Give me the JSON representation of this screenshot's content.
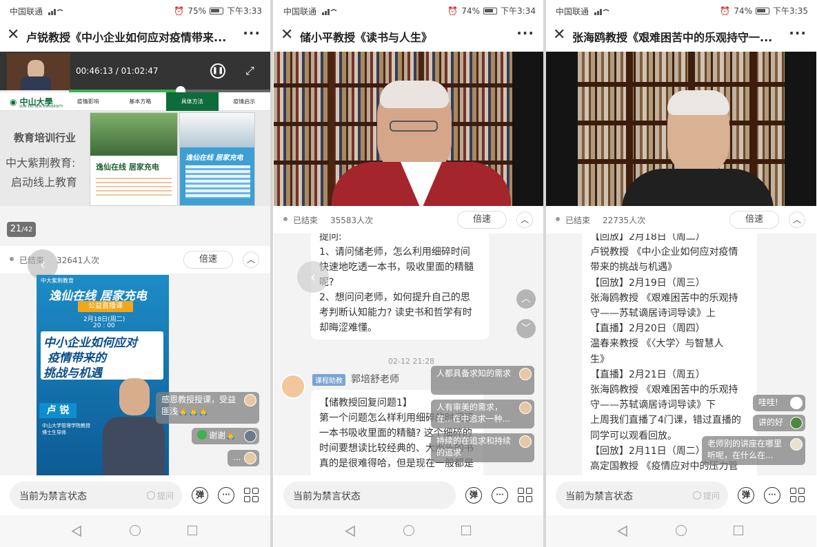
{
  "phones": [
    {
      "status": {
        "carrier": "中国联通",
        "battery": "75%",
        "time": "下午3:33"
      },
      "title": "卢锐教授《中小企业如何应对疫情带来...",
      "video": {
        "time": "00:46:13 / 01:02:47",
        "progress": 0.74,
        "logo": "中山大學",
        "logo_en": "SUN YAT-SEN UNIVERSITY",
        "tabs": [
          "疫情影响",
          "基本方略",
          "具体方法",
          "疫情启示"
        ],
        "active_tab": 2,
        "slide_heading": "教育培训行业",
        "slide_lines": [
          "中大紫荆教育:",
          "启动线上教育"
        ],
        "page_num": "21",
        "page_total": "/42",
        "poster1": "逸仙在线 居家充电",
        "poster2": "逸仙在线 居家充电"
      },
      "info": {
        "ended": "已结束",
        "viewers": "32641人次",
        "speed": "倍速"
      },
      "poster": {
        "brand": "中大紫荆教育",
        "headline": "逸仙在线 居家充电",
        "sub": "公益直播课",
        "date": "2月18日(周二)",
        "hour": "20 : 00",
        "topic_lines": [
          "中小企业如何应对",
          "疫情带来的",
          "挑战与机遇"
        ],
        "speaker": "卢 锐",
        "speaker_desc_lines": [
          "中山大学管理学院教授",
          "博士生导师"
        ]
      },
      "danmu": [
        {
          "text": "感恩教授授课，受益匪浅🙏🙏🙏"
        },
        {
          "text": "谢谢🙏"
        },
        {
          "text": "..."
        }
      ],
      "input": {
        "placeholder": "当前为禁言状态",
        "ask": "提问"
      }
    },
    {
      "status": {
        "carrier": "中国联通",
        "battery": "74%",
        "time": "下午3:34"
      },
      "title": "储小平教授《读书与人生》",
      "info": {
        "ended": "已结束",
        "viewers": "35583人次",
        "speed": "倍速"
      },
      "question_lines": [
        "提问:",
        "1、请问储老师，怎么利用细碎时间",
        "快速地吃透一本书，吸收里面的精髓",
        "呢?",
        "2、想问问老师，如何提升自己的思",
        "考判断认知能力? 读史书和哲学有时",
        "却晦涩难懂。"
      ],
      "timestamp": "02-12 21:28",
      "assistant_badge": "课程助教",
      "assistant_name": "郭培舒老师",
      "reply_lines": [
        "【储教授回复问题1】",
        "第一个问题怎么样利用细碎的时间读",
        "一本书吸收里面的精髓? 这个细碎的",
        "时间要想读比较经典的、大部头的书",
        "真的是很难得哈，但是现在一般都是"
      ],
      "danmu": [
        {
          "text": "人都具备求知的需求"
        },
        {
          "text": "人有审美的需求，在...在中追求一种..."
        },
        {
          "text": "持续的在追求和持续的追求"
        }
      ],
      "input": {
        "placeholder": "当前为禁言状态"
      }
    },
    {
      "status": {
        "carrier": "中国联通",
        "battery": "74%",
        "time": "下午3:35"
      },
      "title": "张海鸥教授《艰难困苦中的乐观持守一...",
      "info": {
        "ended": "已结束",
        "viewers": "22735人次",
        "speed": "倍速"
      },
      "schedule_lines": [
        "【回放】2月18日（周二）",
        "卢锐教授 《中小企业如何应对疫情",
        "带来的挑战与机遇》",
        "【回放】2月19日（周三）",
        "张海鸥教授 《艰难困苦中的乐观持",
        "守——苏轼谪居诗词导读》上",
        "【直播】2月20日（周四）",
        "温春来教授 《〈大学〉与智慧人",
        "生》",
        "【直播】2月21日（周五）",
        "张海鸥教授 《艰难困苦中的乐观持",
        "守——苏轼谪居诗词导读》下",
        "上周我们直播了4门课，错过直播的",
        "同学可以观看回放。",
        "【回放】2月11日（周二）",
        "高定国教授 《疫情应对中的压力管"
      ],
      "danmu": [
        {
          "text": "哇哇!"
        },
        {
          "text": "讲的好"
        },
        {
          "text": "老师别的讲座在哪里听呢，在什么在..."
        }
      ],
      "input": {
        "placeholder": "当前为禁言状态",
        "ask": "提问"
      }
    }
  ],
  "common": {
    "danmu_btn": "弹"
  }
}
